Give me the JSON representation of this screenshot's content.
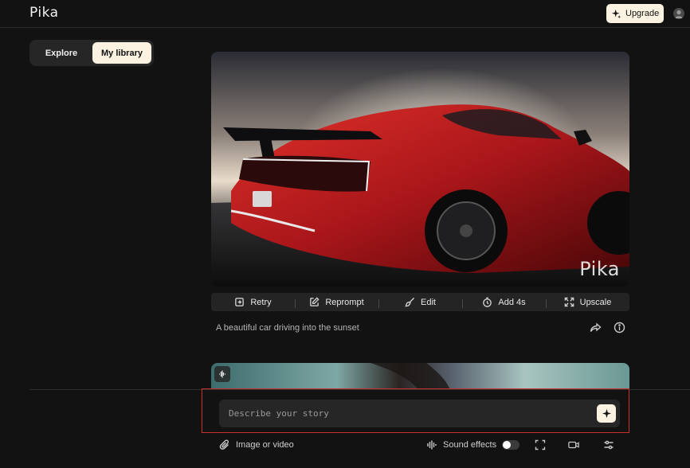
{
  "app": {
    "logo": "Pika",
    "upgrade_label": "Upgrade"
  },
  "tabs": [
    {
      "label": "Explore",
      "active": false
    },
    {
      "label": "My library",
      "active": true
    }
  ],
  "video1": {
    "watermark": "Pika",
    "actions": [
      {
        "label": "Retry",
        "icon": "retry-icon"
      },
      {
        "label": "Reprompt",
        "icon": "edit-square-icon"
      },
      {
        "label": "Edit",
        "icon": "brush-icon"
      },
      {
        "label": "Add 4s",
        "icon": "timer-plus-icon"
      },
      {
        "label": "Upscale",
        "icon": "expand-icon"
      }
    ],
    "caption": "A beautiful car driving into the sunset"
  },
  "prompt": {
    "placeholder": "Describe your story",
    "value": ""
  },
  "toolbar": {
    "attach_label": "Image or video",
    "sound_label": "Sound effects",
    "sound_on": false
  },
  "colors": {
    "accent": "#fbf2e2",
    "background": "#121212",
    "focus": "#c8302c"
  }
}
